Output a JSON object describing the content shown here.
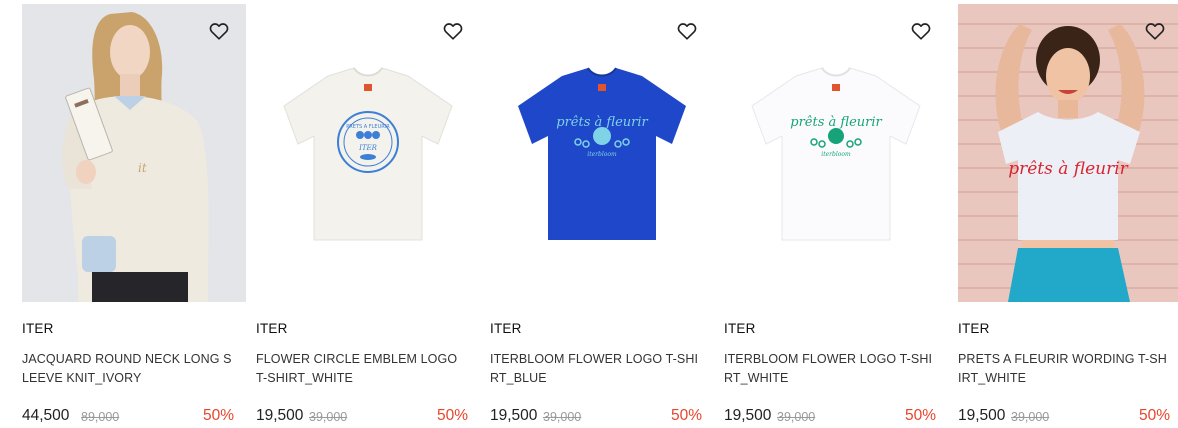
{
  "products": [
    {
      "brand": "ITER",
      "name": "JACQUARD ROUND NECK LONG SLEEVE KNIT_IVORY",
      "price": "44,500",
      "original_price": "89,000",
      "discount": "50%",
      "wishlist_icon": "heart-icon"
    },
    {
      "brand": "ITER",
      "name": "FLOWER CIRCLE EMBLEM LOGO T-SHIRT_WHITE",
      "price": "19,500",
      "original_price": "39,000",
      "discount": "50%",
      "wishlist_icon": "heart-icon"
    },
    {
      "brand": "ITER",
      "name": "ITERBLOOM FLOWER LOGO T-SHIRT_BLUE",
      "price": "19,500",
      "original_price": "39,000",
      "discount": "50%",
      "wishlist_icon": "heart-icon"
    },
    {
      "brand": "ITER",
      "name": "ITERBLOOM FLOWER LOGO T-SHIRT_WHITE",
      "price": "19,500",
      "original_price": "39,000",
      "discount": "50%",
      "wishlist_icon": "heart-icon"
    },
    {
      "brand": "ITER",
      "name": "PRETS A FLEURIR WORDING T-SHIRT_WHITE",
      "price": "19,500",
      "original_price": "39,000",
      "discount": "50%",
      "wishlist_icon": "heart-icon"
    }
  ],
  "print_text": {
    "emblem_top": "PRETS A FLEURIR",
    "emblem_mid": "ITER",
    "flower_script": "prêts à fleurir",
    "flower_sub": "iterbloom",
    "wording": "prêts à fleurir"
  },
  "colors": {
    "discount": "#e8452c",
    "blue_tee": "#1f47c9",
    "green_print": "#17a37a",
    "red_print": "#d9232e",
    "emblem_blue": "#3d7fd6"
  }
}
